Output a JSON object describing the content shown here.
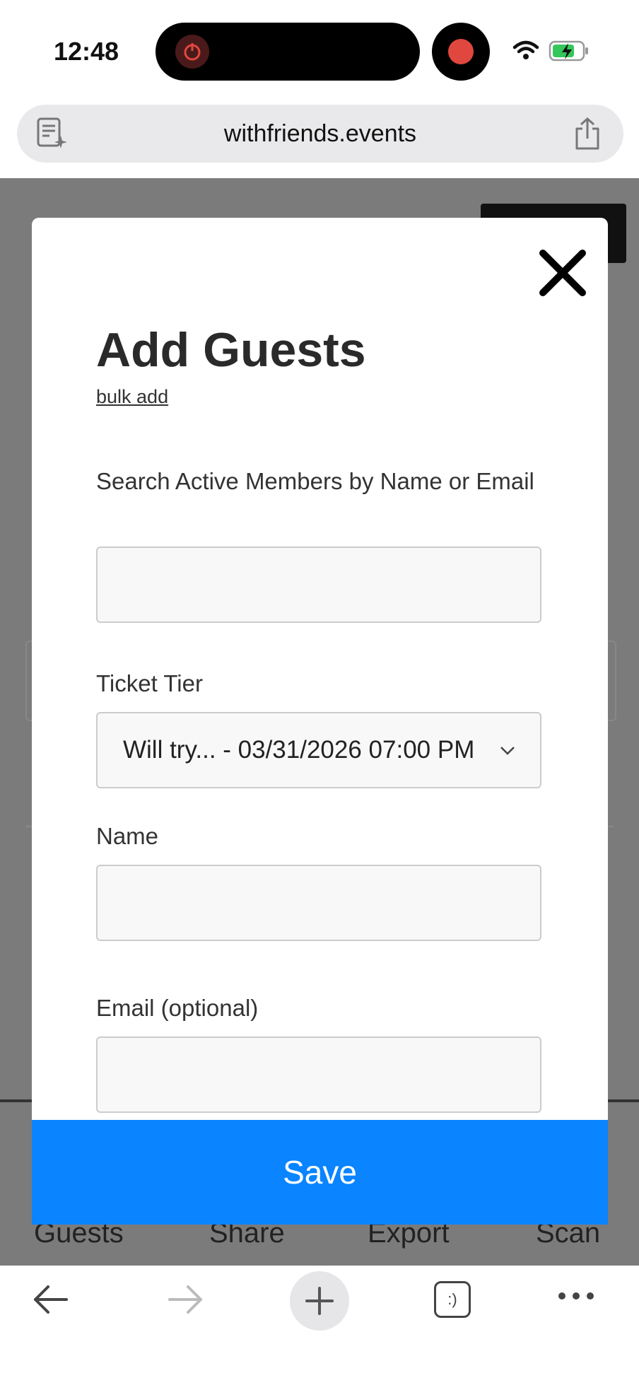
{
  "status": {
    "time": "12:48"
  },
  "browser": {
    "url": "withfriends.events"
  },
  "background_tabs": [
    "Guests",
    "Share",
    "Export",
    "Scan"
  ],
  "modal": {
    "title": "Add Guests",
    "bulk_add_link": "bulk add",
    "search": {
      "label": "Search Active Members by Name or Email",
      "value": ""
    },
    "ticket_tier": {
      "label": "Ticket Tier",
      "selected": "Will try... - 03/31/2026 07:00 PM"
    },
    "name": {
      "label": "Name",
      "value": ""
    },
    "email": {
      "label": "Email (optional)",
      "value": ""
    },
    "save_label": "Save"
  },
  "toolbar": {
    "tabs_label": ":)"
  },
  "colors": {
    "accent": "#0a84ff",
    "record": "#e0473e"
  }
}
